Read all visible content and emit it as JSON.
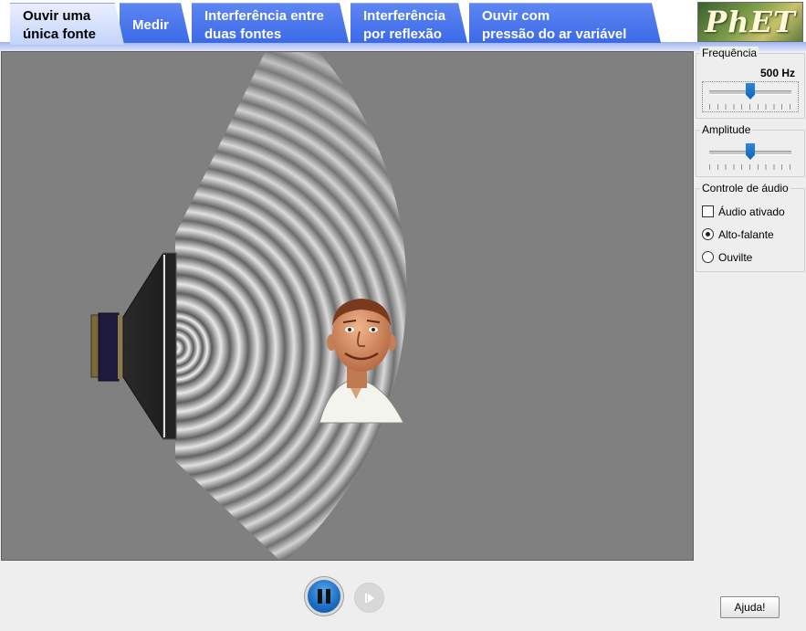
{
  "tabs": [
    {
      "line1": "Ouvir uma",
      "line2": "única fonte",
      "active": true
    },
    {
      "line1": "Medir",
      "line2": ""
    },
    {
      "line1": "Interferência entre",
      "line2": "duas fontes"
    },
    {
      "line1": "Interferência",
      "line2": "por reflexão"
    },
    {
      "line1": "Ouvir com",
      "line2": "pressão do ar variável"
    }
  ],
  "logo": {
    "text": "PhET"
  },
  "panel": {
    "frequency": {
      "title": "Frequência",
      "value_label": "500 Hz",
      "level": 0.5
    },
    "amplitude": {
      "title": "Amplitude",
      "level": 0.5
    },
    "audio": {
      "title": "Controle de áudio",
      "enabled_label": "Áudio ativado",
      "enabled": false,
      "options": [
        "Alto-falante",
        "Ouvilte"
      ],
      "selected": "Alto-falante"
    }
  },
  "playback": {
    "state": "playing"
  },
  "help": {
    "label": "Ajuda!"
  },
  "icons": {
    "pause": "pause-icon",
    "step": "step-forward-icon",
    "speaker": "speaker-icon",
    "listener": "listener-head-icon"
  }
}
